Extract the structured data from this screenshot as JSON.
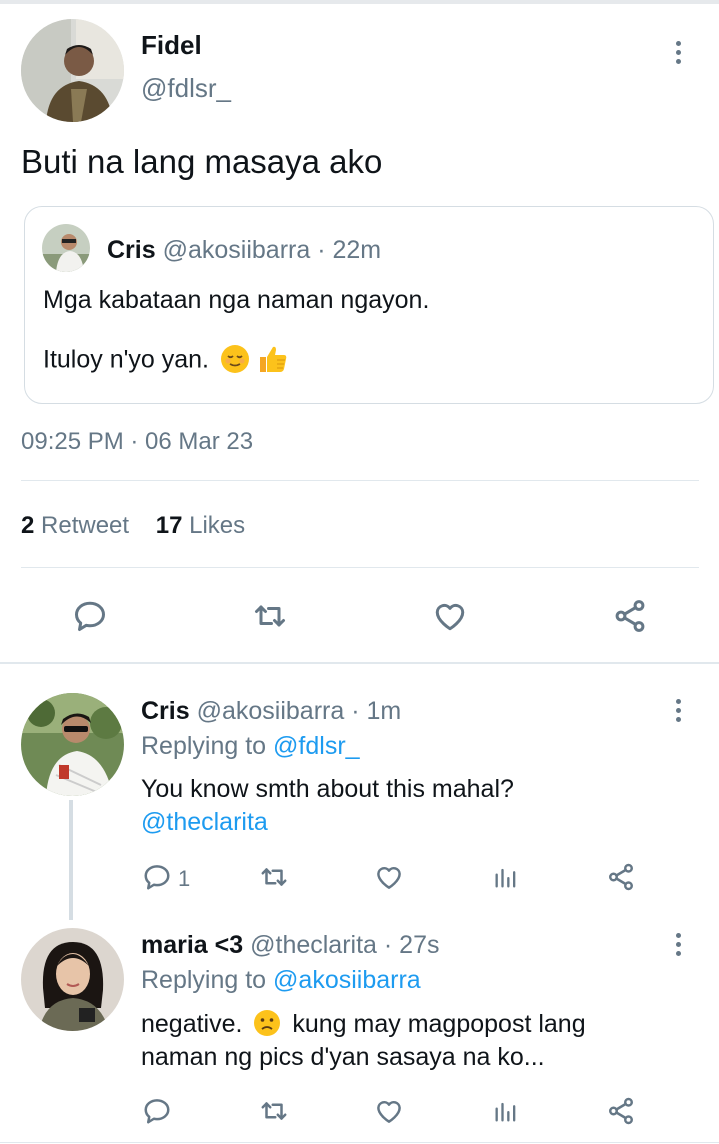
{
  "main_tweet": {
    "author_name": "Fidel",
    "author_handle": "@fdlsr_",
    "text": "Buti na lang masaya ako",
    "quoted": {
      "author_name": "Cris",
      "author_handle": "@akosiibarra",
      "age": "· 22m",
      "line1": "Mga kabataan nga naman ngayon.",
      "line2": "Ituloy n'yo yan."
    },
    "timestamp": "09:25 PM · 06 Mar 23",
    "retweet_count": "2",
    "retweet_label": "Retweet",
    "likes_count": "17",
    "likes_label": "Likes"
  },
  "replies": [
    {
      "author_name": "Cris",
      "author_handle": "@akosiibarra",
      "age": "· 1m",
      "replying_label": "Replying to",
      "replying_to": "@fdlsr_",
      "text": "You know smth about this mahal?",
      "mention": "@theclarita",
      "reply_count": "1"
    },
    {
      "author_name": "maria <3",
      "author_handle": "@theclarita",
      "age": "· 27s",
      "replying_label": "Replying to",
      "replying_to": "@akosiibarra",
      "text_part1": "negative.",
      "text_part2": "kung may magpopost lang",
      "text_line2": "naman ng pics d'yan sasaya na ko..."
    }
  ],
  "colors": {
    "link": "#1d9bf0",
    "muted": "#657786",
    "divider": "#e1e8ed"
  }
}
